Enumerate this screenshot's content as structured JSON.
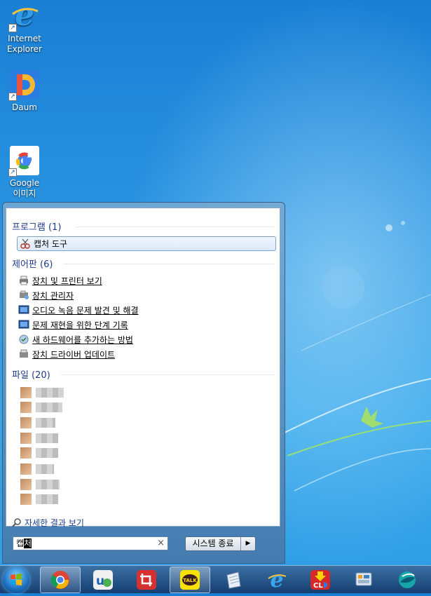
{
  "desktop": {
    "icons": [
      {
        "label_line1": "Internet",
        "label_line2": "Explorer"
      },
      {
        "label_line1": "Daum",
        "label_line2": ""
      },
      {
        "label_line1": "Google",
        "label_line2": "이미지"
      }
    ]
  },
  "start_menu": {
    "groups": {
      "programs": "프로그램 (1)",
      "control_panel": "제어판 (6)",
      "files": "파일 (20)"
    },
    "programs": [
      "캡처 도구"
    ],
    "control_panel": [
      "장치 및 프린터 보기",
      "장치 관리자",
      "오디오 녹음 문제 발견 및 해결",
      "문제 재현을 위한 단계 기록",
      "새 하드웨어를 추가하는 방법",
      "장치 드라이버 업데이트"
    ],
    "more_results": "자세한 결과 보기",
    "search": {
      "value_plain": "캡",
      "value_selected": "처",
      "clear": "×"
    },
    "shutdown": {
      "label": "시스템 종료",
      "arrow": "▶"
    }
  },
  "taskbar": {
    "items": [
      "chrome",
      "ultraedit",
      "screenshot-pro",
      "kakaotalk",
      "notepad",
      "internet-explorer",
      "clean-shield",
      "control-panel",
      "browser-globe"
    ]
  },
  "colors": {
    "accent": "#1e3c8c",
    "selection": "#dce9fa"
  }
}
